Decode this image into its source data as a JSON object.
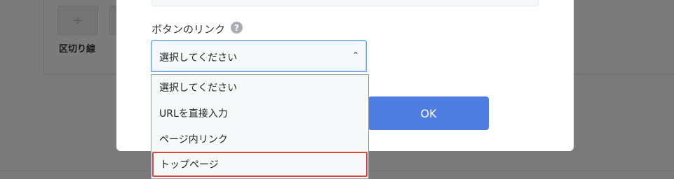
{
  "background": {
    "divider_label": "区切り線",
    "divider_glyph": "÷"
  },
  "modal": {
    "field_label": "ボタンのリンク",
    "help_glyph": "?",
    "select_value": "選択してください",
    "chevron": "⌃",
    "ok_label": "OK"
  },
  "dropdown": {
    "options": [
      "選択してください",
      "URLを直接入力",
      "ページ内リンク",
      "トップページ"
    ],
    "highlighted_index": 3
  },
  "colors": {
    "accent": "#4f7ee3",
    "focus_border": "#5aa2f0",
    "highlight_border": "#e0443c",
    "overlay": "#7b7b7b"
  }
}
